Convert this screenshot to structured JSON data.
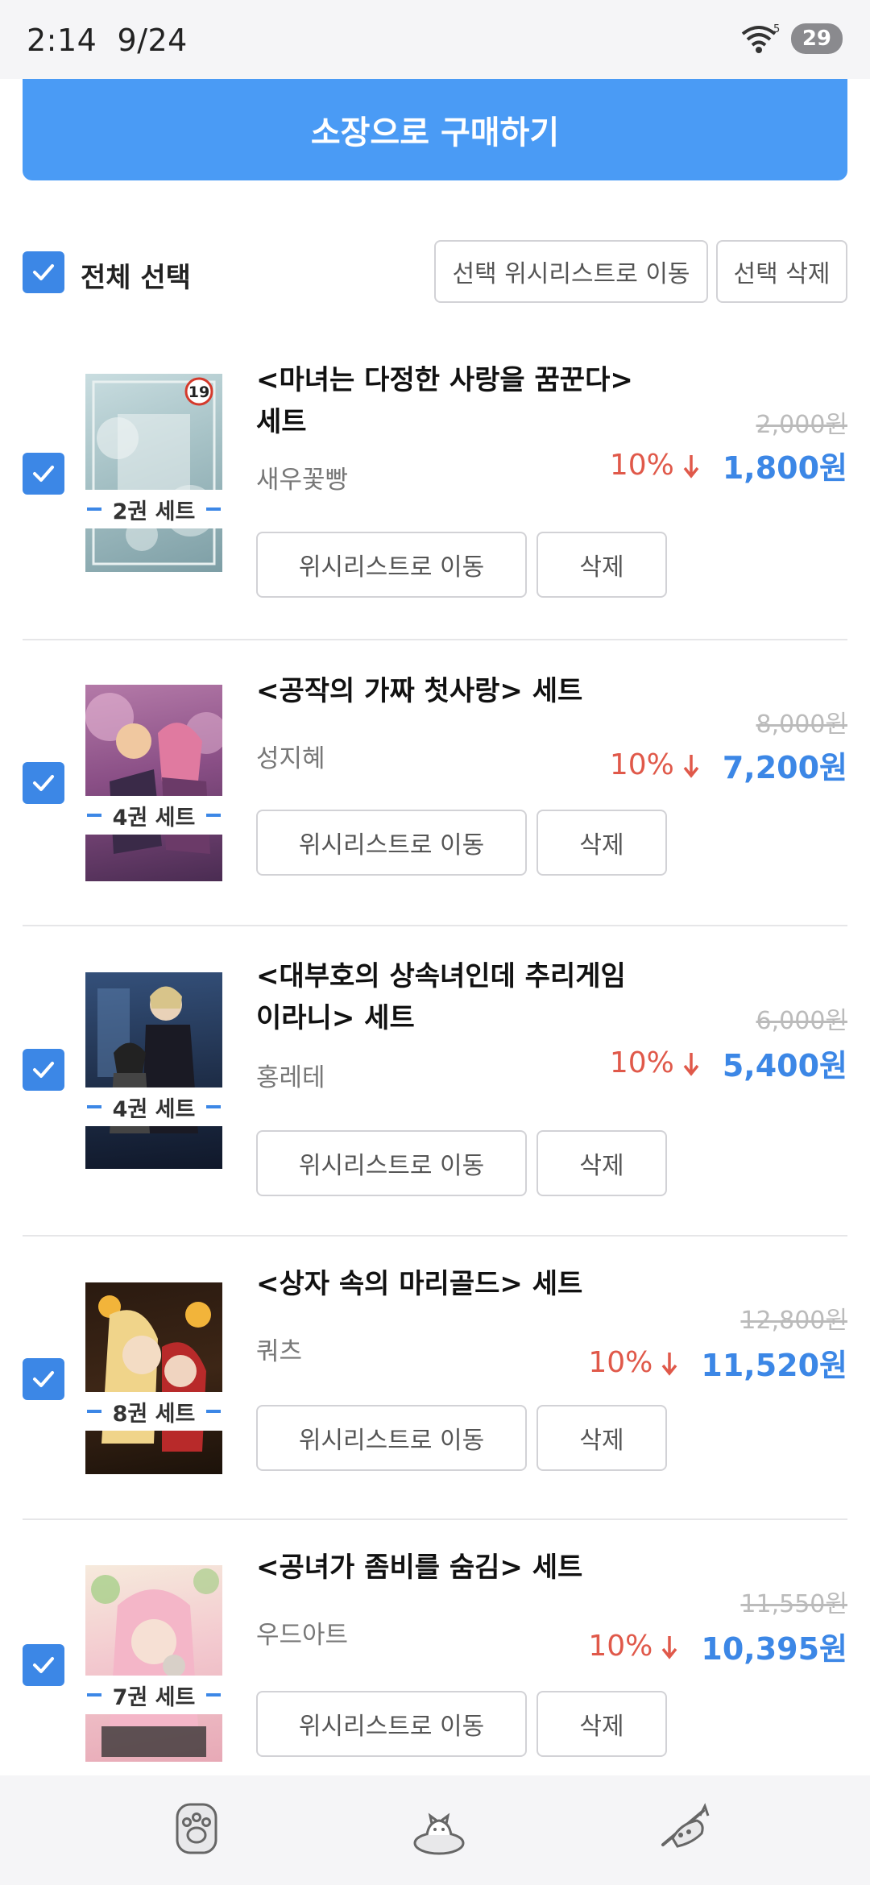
{
  "status_bar": {
    "time": "2:14",
    "date": "9/24",
    "wifi_label": "5",
    "battery": "29"
  },
  "buy_button": "소장으로 구매하기",
  "select_all": {
    "label": "전체 선택",
    "move_selected": "선택 위시리스트로 이동",
    "delete_selected": "선택 삭제"
  },
  "item_actions": {
    "move": "위시리스트로 이동",
    "delete": "삭제"
  },
  "items": [
    {
      "title_line1": "<마녀는 다정한 사랑을 꿈꾼다>",
      "title_line2": "세트",
      "author": "새우꽃빵",
      "badge": "2권 세트",
      "orig_price": "2,000원",
      "discount": "10%",
      "price": "1,800원",
      "age_badge": "19"
    },
    {
      "title_line1": "<공작의 가짜 첫사랑> 세트",
      "title_line2": "",
      "author": "성지혜",
      "badge": "4권 세트",
      "orig_price": "8,000원",
      "discount": "10%",
      "price": "7,200원"
    },
    {
      "title_line1": "<대부호의 상속녀인데 추리게임",
      "title_line2": "이라니> 세트",
      "author": "홍레테",
      "badge": "4권 세트",
      "orig_price": "6,000원",
      "discount": "10%",
      "price": "5,400원"
    },
    {
      "title_line1": "<상자 속의 마리골드> 세트",
      "title_line2": "",
      "author": "쿼츠",
      "badge": "8권 세트",
      "orig_price": "12,800원",
      "discount": "10%",
      "price": "11,520원"
    },
    {
      "title_line1": "<공녀가 좀비를 숨김> 세트",
      "title_line2": "",
      "author": "우드아트",
      "badge": "7권 세트",
      "orig_price": "11,550원",
      "discount": "10%",
      "price": "10,395원"
    }
  ],
  "colors": {
    "accent": "#3c87e6",
    "buy_button": "#4a9bf5",
    "discount": "#e0594a"
  },
  "bottom_nav": [
    "paw-icon",
    "cat-bed-icon",
    "cat-playing-icon"
  ]
}
